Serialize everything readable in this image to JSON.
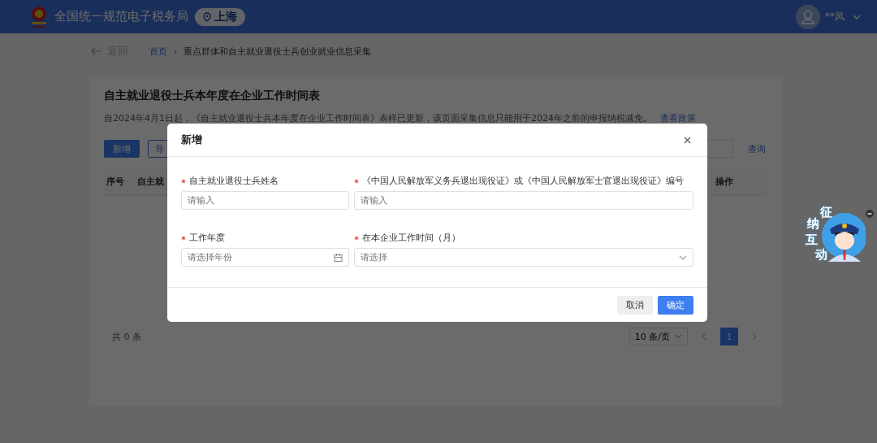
{
  "header": {
    "title": "全国统一规范电子税务局",
    "region": "上海",
    "user": "**凤"
  },
  "breadcrumb": {
    "back": "返回",
    "separator": "›",
    "items": [
      {
        "label": "首页",
        "kind": "link"
      },
      {
        "label": "重点群体和自主就业退役士兵创业就业信息采集",
        "kind": "current"
      }
    ]
  },
  "card": {
    "title": "自主就业退役士兵本年度在企业工作时间表",
    "notice": "自2024年4月1日起，《自主就业退役士兵本年度在企业工作时间表》表样已更新，该页面采集信息只能用于2024年之前的申报纳税减免。",
    "notice_link": "查看政策",
    "toolbar": {
      "buttons": [
        {
          "label": "新增",
          "kind": "primary"
        },
        {
          "label": "导",
          "kind": "outline"
        }
      ],
      "query": "查询"
    },
    "table": {
      "columns": [
        "序号",
        "自主就",
        "操作"
      ]
    },
    "pagination": {
      "total": "共 0 条",
      "page_size": "10 条/页",
      "pages": [
        {
          "label": "1",
          "selected": true
        }
      ]
    }
  },
  "dialog": {
    "title": "新增",
    "fields": [
      {
        "label": "自主就业退役士兵姓名",
        "placeholder": "请输入",
        "required": true,
        "kind": "text"
      },
      {
        "label": "《中国人民解放军义务兵退出现役证》或《中国人民解放军士官退出现役证》编号",
        "placeholder": "请输入",
        "required": true,
        "kind": "text"
      },
      {
        "label": "工作年度",
        "placeholder": "请选择年份",
        "required": true,
        "kind": "date"
      },
      {
        "label": "在本企业工作时间（月）",
        "placeholder": "请选择",
        "required": true,
        "kind": "select"
      }
    ],
    "buttons": [
      {
        "label": "取消",
        "kind": "secondary"
      },
      {
        "label": "确定",
        "kind": "primary"
      }
    ]
  },
  "assistant": {
    "chars": [
      "征",
      "纳",
      "互",
      "动"
    ]
  }
}
